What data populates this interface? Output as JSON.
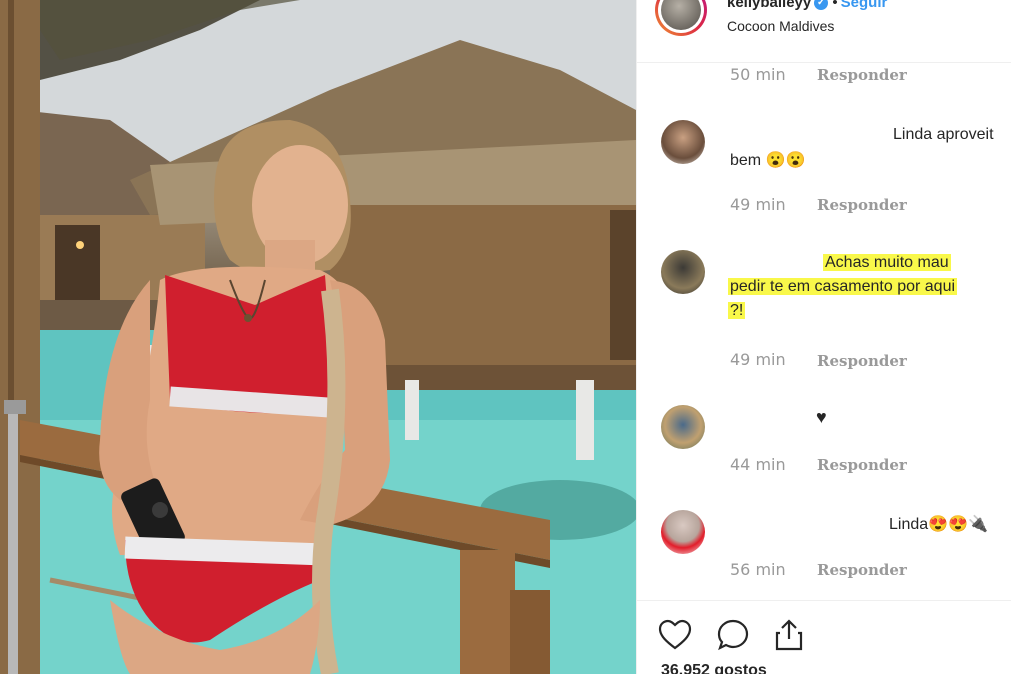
{
  "header": {
    "username": "kellybaileyy",
    "separator": "•",
    "follow_label": "Seguir",
    "location": "Cocoon Maldives"
  },
  "reply_label": "Responder",
  "comments": [
    {
      "time": "50 min"
    },
    {
      "text_line1": "Linda aproveit",
      "text_line2": "bem 😮😮",
      "time": "49 min"
    },
    {
      "text_line1": "Achas muito mau",
      "text_line2": "pedir te em casamento por aqui",
      "text_line3": "?!",
      "time": "49 min"
    },
    {
      "text": "♥",
      "time": "44 min"
    },
    {
      "text": "Linda😍😍🔌",
      "time": "56 min"
    }
  ],
  "likes_text": "36.952 gostos",
  "colors": {
    "highlight": "#f9f84a",
    "link": "#3897f0",
    "muted": "#999999"
  },
  "icons": [
    "heart-icon",
    "comment-icon",
    "share-icon",
    "verified-badge-icon"
  ]
}
